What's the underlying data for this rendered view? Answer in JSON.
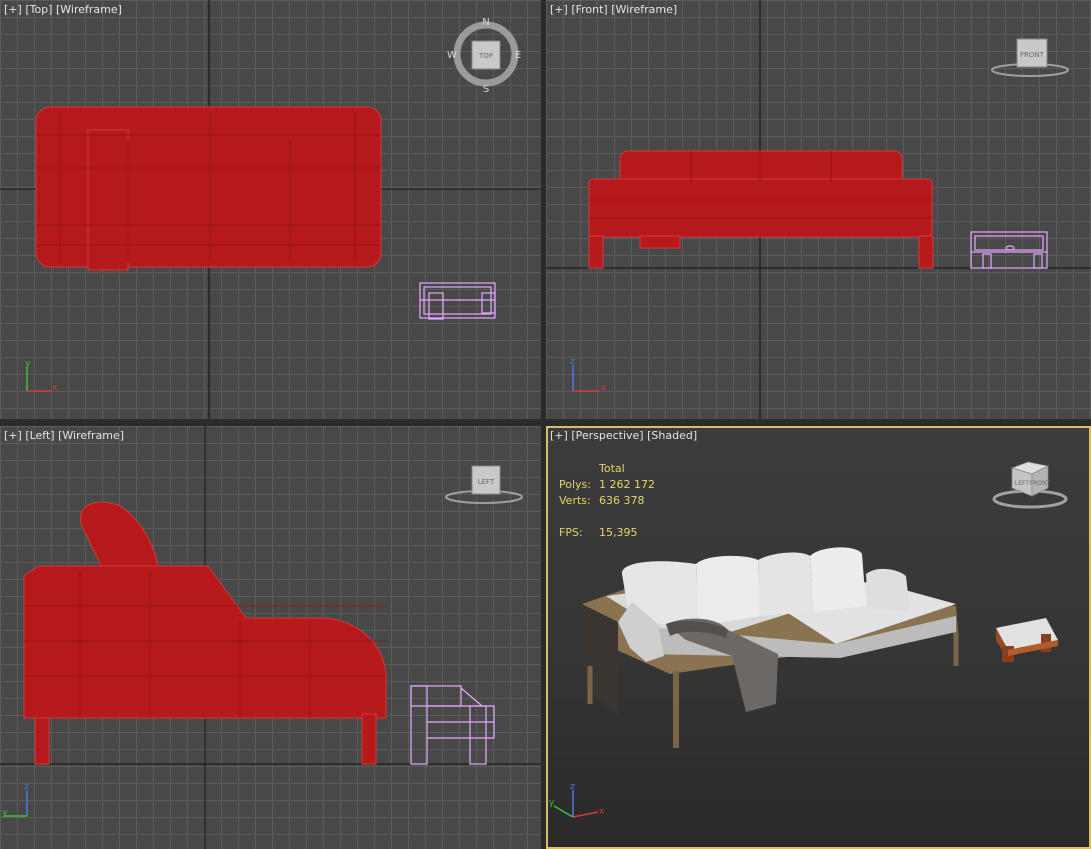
{
  "viewports": {
    "top": {
      "plus": "[+]",
      "view": "[Top]",
      "mode": "[Wireframe]",
      "cube_label": "TOP",
      "compass": {
        "n": "N",
        "s": "S",
        "e": "E",
        "w": "W"
      }
    },
    "front": {
      "plus": "[+]",
      "view": "[Front]",
      "mode": "[Wireframe]",
      "cube_label": "FRONT"
    },
    "left": {
      "plus": "[+]",
      "view": "[Left]",
      "mode": "[Wireframe]",
      "cube_label": "LEFT"
    },
    "perspective": {
      "plus": "[+]",
      "view": "[Perspective]",
      "mode": "[Shaded]",
      "cube_labels": {
        "left": "LEFT",
        "front": "FRONT"
      },
      "stats": {
        "header": "Total",
        "polys_label": "Polys:",
        "polys_value": "1 262 172",
        "verts_label": "Verts:",
        "verts_value": "636 378",
        "fps_label": "FPS:",
        "fps_value": "15,395"
      }
    }
  },
  "axis_labels": {
    "x": "x",
    "y": "y",
    "z": "z"
  },
  "colors": {
    "selection_red": "#b5191c",
    "wire_pink": "#e6a8ff",
    "grid_line": "#5c5c5c",
    "grid_axis": "#1e1e1e",
    "viewport_bg": "#484848",
    "active_border": "#d9bd6a",
    "stats_text": "#e7d46a",
    "axis_x": "#d43a3a",
    "axis_y": "#3fbf3f",
    "axis_z": "#4a78e0"
  },
  "icons": {
    "view_cube": "view-cube-icon",
    "compass": "compass-ring-icon",
    "axis_tripod": "axis-tripod-icon"
  }
}
